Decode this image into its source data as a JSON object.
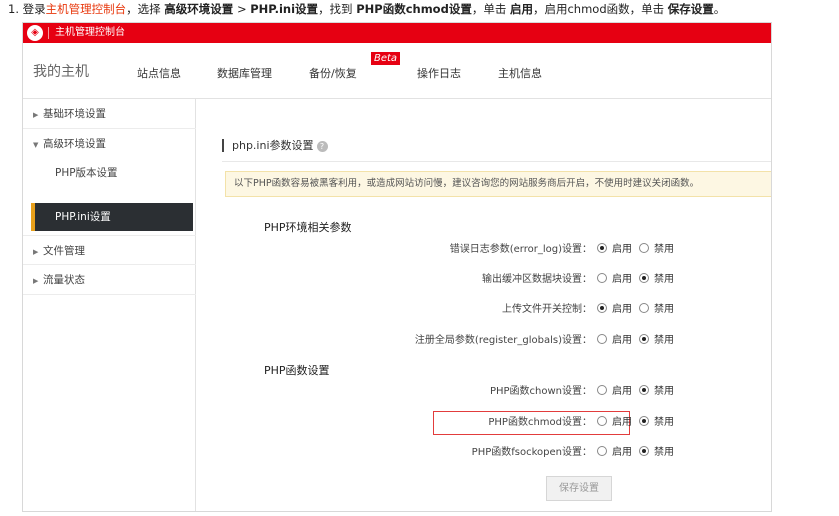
{
  "instruction": {
    "step": "1. 登录",
    "link": "主机管理控制台",
    "p1": "，选择 ",
    "b1": "高级环境设置",
    "p2": " > ",
    "b2": "PHP.ini设置",
    "p3": "，找到 ",
    "b3": "PHP函数chmod设置",
    "p4": "，单击 ",
    "b4": "启用",
    "p5": "，启用chmod函数，单击 ",
    "b5": "保存设置",
    "p6": "。"
  },
  "topbar": {
    "logo": "◈",
    "title": "主机管理控制台"
  },
  "nav": {
    "home": "我的主机",
    "items": [
      "站点信息",
      "数据库管理",
      "备份/恢复",
      "操作日志",
      "主机信息"
    ],
    "beta": "Beta"
  },
  "sidebar": {
    "basic": "基础环境设置",
    "advanced": "高级环境设置",
    "php_version": "PHP版本设置",
    "php_ini": "PHP.ini设置",
    "files": "文件管理",
    "traffic": "流量状态"
  },
  "content": {
    "section_title": "php.ini参数设置",
    "help_icon": "?",
    "notice": "以下PHP函数容易被黑客利用，或造成网站访问慢，建议咨询您的网站服务商后开启，不使用时建议关闭函数。",
    "group1_title": "PHP环境相关参数",
    "group2_title": "PHP函数设置",
    "enable": "启用",
    "disable": "禁用",
    "rows": [
      {
        "label": "错误日志参数(error_log)设置：",
        "selected": "enable"
      },
      {
        "label": "输出缓冲区数据块设置：",
        "selected": "disable"
      },
      {
        "label": "上传文件开关控制：",
        "selected": "enable"
      },
      {
        "label": "注册全局参数(register_globals)设置：",
        "selected": "disable"
      },
      {
        "label": "PHP函数chown设置：",
        "selected": "disable"
      },
      {
        "label": "PHP函数chmod设置：",
        "selected": "disable"
      },
      {
        "label": "PHP函数fsockopen设置：",
        "selected": "disable"
      }
    ],
    "save_button": "保存设置"
  },
  "colors": {
    "brand": "#e60012",
    "highlight": "#e8380d",
    "active_mark": "#e8a01b"
  }
}
